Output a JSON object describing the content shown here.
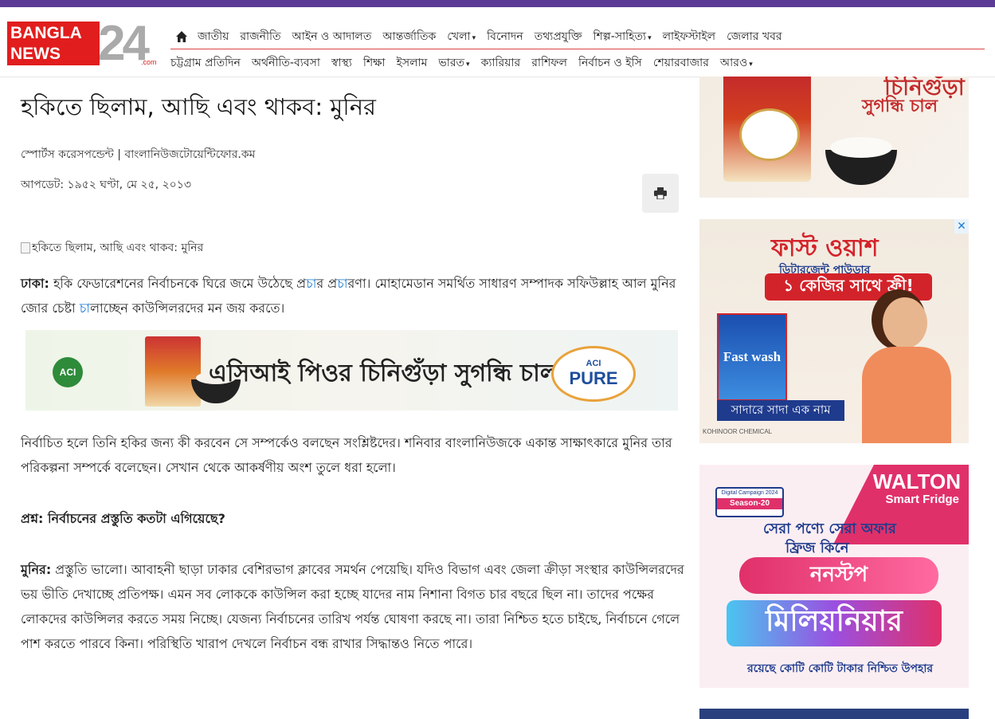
{
  "brand": {
    "logo_line1": "BANGLA",
    "logo_line2": "NEWS",
    "logo_number": "24",
    "logo_domain": ".com"
  },
  "nav": {
    "row1": [
      {
        "label": "জাতীয়",
        "dropdown": false
      },
      {
        "label": "রাজনীতি",
        "dropdown": false
      },
      {
        "label": "আইন ও আদালত",
        "dropdown": false
      },
      {
        "label": "আন্তর্জাতিক",
        "dropdown": false
      },
      {
        "label": "খেলা",
        "dropdown": true
      },
      {
        "label": "বিনোদন",
        "dropdown": false
      },
      {
        "label": "তথ্যপ্রযুক্তি",
        "dropdown": false
      },
      {
        "label": "শিল্প-সাহিত্য",
        "dropdown": true
      },
      {
        "label": "লাইফস্টাইল",
        "dropdown": false
      },
      {
        "label": "জেলার খবর",
        "dropdown": false
      }
    ],
    "row2": [
      {
        "label": "চট্টগ্রাম প্রতিদিন",
        "dropdown": false
      },
      {
        "label": "অর্থনীতি-ব্যবসা",
        "dropdown": false
      },
      {
        "label": "স্বাস্থ্য",
        "dropdown": false
      },
      {
        "label": "শিক্ষা",
        "dropdown": false
      },
      {
        "label": "ইসলাম",
        "dropdown": false
      },
      {
        "label": "ভারত",
        "dropdown": true
      },
      {
        "label": "ক্যারিয়ার",
        "dropdown": false
      },
      {
        "label": "রাশিফল",
        "dropdown": false
      },
      {
        "label": "নির্বাচন ও ইসি",
        "dropdown": false
      },
      {
        "label": "শেয়ারবাজার",
        "dropdown": false
      },
      {
        "label": "আরও",
        "dropdown": true
      }
    ],
    "home_icon": "home-icon"
  },
  "article": {
    "title": "হকিতে ছিলাম, আছি এবং থাকব: মুনির",
    "byline": "স্পোর্টস করেসপন্ডেন্ট | বাংলানিউজটোয়েন্টিফোর.কম",
    "updated": "আপডেট: ১৯৫২ ঘণ্টা, মে ২৫, ২০১৩",
    "print_icon": "print-icon",
    "image_alt": "হকিতে ছিলাম, আছি এবং থাকব: মুনির",
    "p1": {
      "lead": "ঢাকা:",
      "t1": " হকি ফেডারেশনের নির্বাচনকে ঘিরে জমে উঠেছে প্র",
      "h1": "চা",
      "t2": "র প্র",
      "h2": "চা",
      "t3": "রণা। মোহামেডান সমর্থিত সাধারণ সম্পাদক সফিউল্লাহ আল মুনির জোর চেষ্টা ",
      "h3": "চা",
      "t4": "লাচ্ছেন কাউন্সিলরদের মন জয় করতে।"
    },
    "p2": "নির্বাচিত হলে তিনি হকির জন্য কী করবেন সে সম্পর্কেও বলছেন সংশ্লিষ্টদের। শনিবার বাংলানিউজকে একান্ত সাক্ষাৎকারে মুনির তার পরিকল্পনা সম্পর্কে বলেছেন। সেখান থেকে আকর্ষণীয় অংশ তুলে ধরা হলো।",
    "q1": "প্রশ্ন: নির্বাচনের প্রস্তুতি কতটা এগিয়েছে?",
    "a1_lead": "মুনির:",
    "a1": " প্রস্তুতি ভালো। আবাহনী ছাড়া ঢাকার বেশিরভাগ ক্লাবের সমর্থন পেয়েছি। যদিও বিভাগ এবং জেলা ক্রীড়া সংস্থার কাউন্সিলরদের ভয় ভীতি দেখাচ্ছে প্রতিপক্ষ। এমন সব লোককে কাউন্সিল করা হচ্ছে যাদের নাম নিশানা বিগত চার বছরে ছিল না। তাদের পক্ষের লোকদের কাউন্সিলর করতে সময় নিচ্ছে। যেজন্য নির্বাচনের তারিখ পর্যন্ত ঘোষণা করছে না। তারা নিশ্চিত হতে চাইছে, নির্বাচনে গেলে পাশ করতে পারবে কিনা। পরিস্থিতি খারাপ দেখলে নির্বাচন বন্ধ রাখার সিদ্ধান্তও নিতে পারে।"
  },
  "ads": {
    "inline": {
      "aci": "ACI",
      "text": "এসিআই পিওর চিনিগুঁড়া সুগন্ধি চাল",
      "badge_small": "ACI",
      "badge_large": "PURE"
    },
    "side1": {
      "line1": "চিনিগুঁড়া",
      "line2": "সুগন্ধি চাল"
    },
    "side2": {
      "brand": "ফাস্ট ওয়াশ",
      "sub": "ডিটারজেন্ট পাউডার",
      "offer": "১ কেজির সাথে ফ্রী!",
      "pack": "Fast wash",
      "slogan": "সাদারে সাদা এক নাম",
      "maker": "KOHINOOR CHEMICAL",
      "close": "✕"
    },
    "side3": {
      "brand": "WALTON",
      "product": "Smart Fridge",
      "campaign_top": "Digital Campaign 2024",
      "campaign_season": "Season-20",
      "line1": "সেরা পণ্যে সেরা অফার",
      "line2": "ফ্রিজ কিনে",
      "big1": "ননস্টপ",
      "big2": "মিলিয়নিয়ার",
      "foot": "রয়েছে কোটি কোটি টাকার নিশ্চিত উপহার"
    }
  },
  "colors": {
    "topbar": "#5b3b95",
    "accent_red": "#e11d1d",
    "link_blue": "#1a7bd1"
  }
}
